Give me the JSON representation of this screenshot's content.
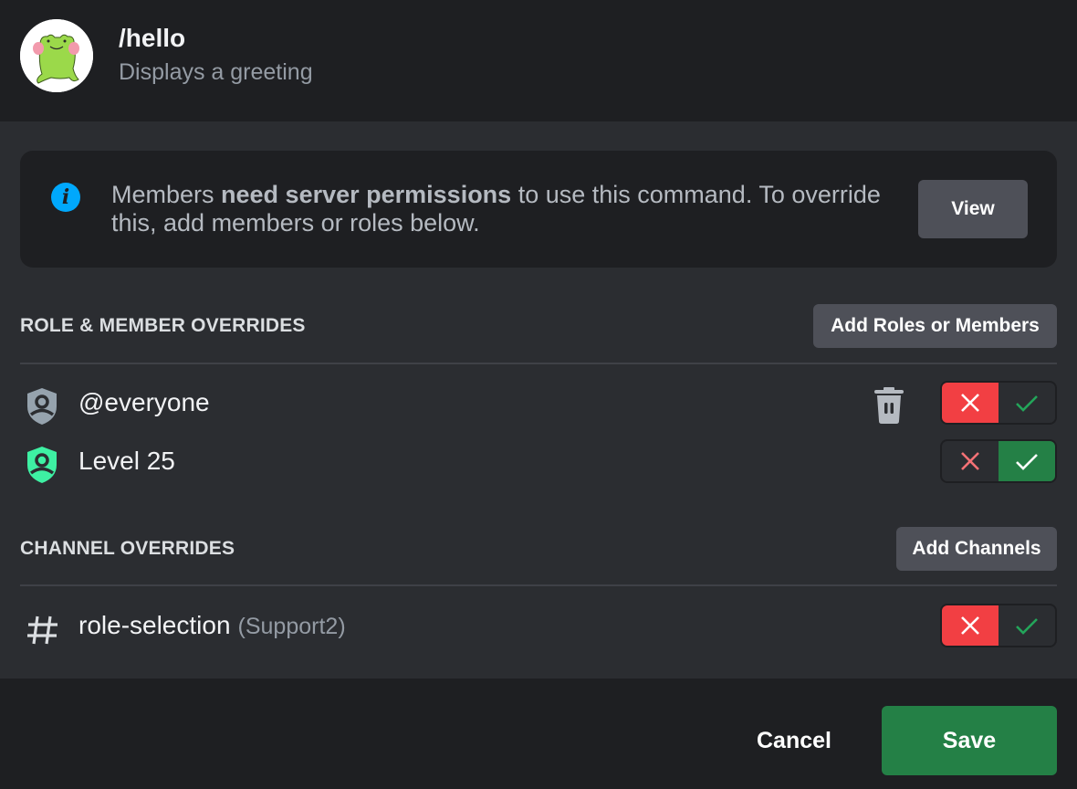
{
  "command": {
    "name": "/hello",
    "description": "Displays a greeting",
    "avatar_icon": "frog-avatar"
  },
  "notice": {
    "icon": "info-icon",
    "text_prefix": "Members ",
    "text_bold": "need server permissions",
    "text_suffix": " to use this command. To override this, add members or roles below.",
    "view_label": "View"
  },
  "role_overrides": {
    "title": "ROLE & MEMBER OVERRIDES",
    "add_label": "Add Roles or Members",
    "items": [
      {
        "label": "@everyone",
        "icon": "role-shield-icon",
        "icon_color": "#96a3ae",
        "deletable": true,
        "state": "deny"
      },
      {
        "label": "Level 25",
        "icon": "role-shield-icon",
        "icon_color": "#3ef0a3",
        "deletable": false,
        "state": "allow"
      }
    ]
  },
  "channel_overrides": {
    "title": "CHANNEL OVERRIDES",
    "add_label": "Add Channels",
    "items": [
      {
        "label": "role-selection",
        "category": "(Support2)",
        "icon": "hash-icon",
        "state": "deny"
      }
    ]
  },
  "footer": {
    "cancel_label": "Cancel",
    "save_label": "Save"
  },
  "colors": {
    "deny": "#f23f43",
    "allow": "#248046",
    "info": "#00a8fc",
    "check_green": "#23a55a",
    "x_red_inactive": "#f47175"
  }
}
